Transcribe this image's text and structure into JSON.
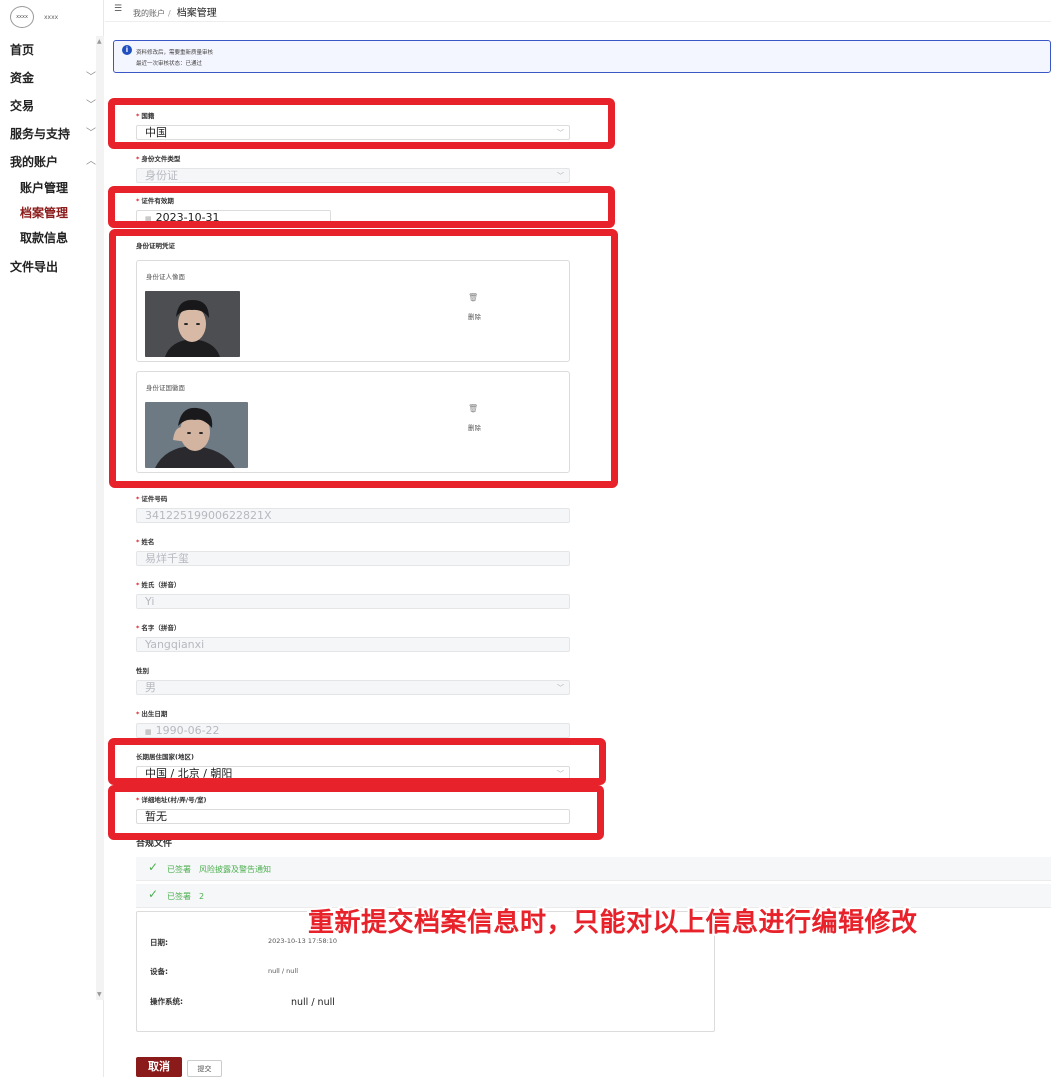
{
  "logo": {
    "mark": "xxxx",
    "text": "xxxx"
  },
  "sidebar": {
    "items": [
      {
        "label": "首页",
        "chevron": ""
      },
      {
        "label": "资金",
        "chevron": "﹀"
      },
      {
        "label": "交易",
        "chevron": "﹀"
      },
      {
        "label": "服务与支持",
        "chevron": "﹀"
      },
      {
        "label": "我的账户",
        "chevron": "︿"
      }
    ],
    "sub_items": [
      "账户管理",
      "档案管理",
      "取款信息"
    ],
    "last_item": "文件导出"
  },
  "breadcrumb": {
    "parent": "我的账户",
    "separator": "/",
    "current": "档案管理"
  },
  "alert": {
    "line1": "资料修改后，需要重新质量审核",
    "line2": "最近一次审核状态：已通过"
  },
  "form": {
    "nationality": {
      "label": "国籍",
      "value": "中国"
    },
    "id_type": {
      "label": "身份文件类型",
      "value": "身份证"
    },
    "validity": {
      "label": "证件有效期",
      "value": "2023-10-31"
    },
    "id_proof": {
      "label": "身份证明凭证"
    },
    "front": {
      "title": "身份证人像面",
      "delete": "删除"
    },
    "back": {
      "title": "身份证国徽面",
      "delete": "删除"
    },
    "id_number": {
      "label": "证件号码",
      "value": "34122519900622821X"
    },
    "name": {
      "label": "姓名",
      "value": "易烊千玺"
    },
    "surname_pinyin": {
      "label": "姓氏（拼音）",
      "value": "Yi"
    },
    "given_pinyin": {
      "label": "名字（拼音）",
      "value": "Yangqianxi"
    },
    "gender": {
      "label": "性别",
      "value": "男"
    },
    "birth": {
      "label": "出生日期",
      "value": "1990-06-22"
    },
    "residence": {
      "label": "长期居住国家(地区)",
      "value": "中国 / 北京 / 朝阳"
    },
    "address": {
      "label": "详细地址(村/弄/号/室)",
      "value": "暂无"
    }
  },
  "compliance": {
    "title": "合规文件",
    "rows": [
      {
        "status": "已签署",
        "name": "风险披露及警告通知"
      },
      {
        "status": "已签署",
        "name": "2"
      }
    ],
    "details": {
      "date_label": "日期:",
      "date_value": "2023-10-13 17:58:10",
      "device_label": "设备:",
      "device_value": "null / null",
      "os_label": "操作系统:",
      "os_value": "null / null"
    }
  },
  "annotation": "重新提交档案信息时，只能对以上信息进行编辑修改",
  "buttons": {
    "cancel": "取消",
    "submit": "提交"
  },
  "colors": {
    "accent": "#8b1a1a",
    "highlight": "#e8222a",
    "success": "#4caf50",
    "info": "#2050c0"
  }
}
